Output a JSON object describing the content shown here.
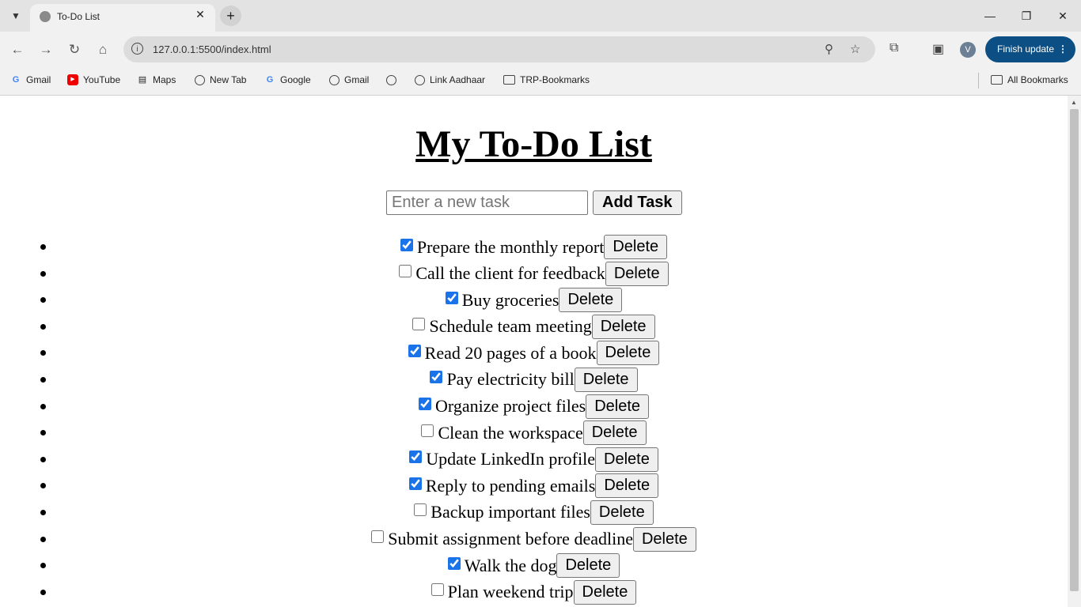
{
  "browser": {
    "tab_title": "To-Do List",
    "tab_close": "✕",
    "new_tab": "+",
    "url": "127.0.0.1:5500/index.html",
    "finish_update": "Finish update",
    "profile_initial": "V",
    "bookmarks": [
      {
        "label": "Gmail",
        "icon": "google-icon"
      },
      {
        "label": "YouTube",
        "icon": "youtube-icon"
      },
      {
        "label": "Maps",
        "icon": "maps-icon"
      },
      {
        "label": "New Tab",
        "icon": "globe-icon"
      },
      {
        "label": "Google",
        "icon": "google-icon"
      },
      {
        "label": "Gmail",
        "icon": "globe-icon"
      },
      {
        "label": "",
        "icon": "globe-icon"
      },
      {
        "label": "Link Aadhaar",
        "icon": "globe-icon"
      },
      {
        "label": "TRP-Bookmarks",
        "icon": "folder-icon"
      }
    ],
    "all_bookmarks": "All Bookmarks"
  },
  "page": {
    "title": "My To-Do List",
    "input_placeholder": "Enter a new task",
    "add_button": "Add Task",
    "delete_label": "Delete"
  },
  "tasks": [
    {
      "text": "Prepare the monthly report",
      "done": true
    },
    {
      "text": "Call the client for feedback",
      "done": false
    },
    {
      "text": "Buy groceries",
      "done": true
    },
    {
      "text": "Schedule team meeting",
      "done": false
    },
    {
      "text": "Read 20 pages of a book",
      "done": true
    },
    {
      "text": "Pay electricity bill",
      "done": true
    },
    {
      "text": "Organize project files",
      "done": true
    },
    {
      "text": "Clean the workspace",
      "done": false
    },
    {
      "text": "Update LinkedIn profile",
      "done": true
    },
    {
      "text": "Reply to pending emails",
      "done": true
    },
    {
      "text": "Backup important files",
      "done": false
    },
    {
      "text": "Submit assignment before deadline",
      "done": false
    },
    {
      "text": "Walk the dog",
      "done": true
    },
    {
      "text": "Plan weekend trip",
      "done": false
    }
  ]
}
